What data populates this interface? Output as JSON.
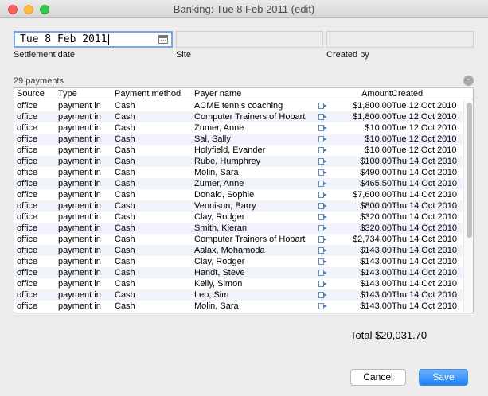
{
  "window": {
    "title": "Banking: Tue 8 Feb 2011 (edit)"
  },
  "form": {
    "settlement_date": {
      "value": "Tue 8 Feb 2011",
      "label": "Settlement date"
    },
    "site": {
      "value": "",
      "label": "Site"
    },
    "created_by": {
      "value": "",
      "label": "Created by"
    }
  },
  "payments": {
    "count_label": "29 payments",
    "remove_label": "−",
    "columns": [
      "Source",
      "Type",
      "Payment method",
      "Payer name",
      "Amount",
      "Created"
    ],
    "rows": [
      {
        "source": "office",
        "type": "payment in",
        "method": "Cash",
        "payer": "ACME tennis coaching",
        "amount": "$1,800.00",
        "created": "Tue 12 Oct 2010"
      },
      {
        "source": "office",
        "type": "payment in",
        "method": "Cash",
        "payer": "Computer Trainers of Hobart",
        "amount": "$1,800.00",
        "created": "Tue 12 Oct 2010"
      },
      {
        "source": "office",
        "type": "payment in",
        "method": "Cash",
        "payer": "Zumer, Anne",
        "amount": "$10.00",
        "created": "Tue 12 Oct 2010"
      },
      {
        "source": "office",
        "type": "payment in",
        "method": "Cash",
        "payer": "Sal, Sally",
        "amount": "$10.00",
        "created": "Tue 12 Oct 2010"
      },
      {
        "source": "office",
        "type": "payment in",
        "method": "Cash",
        "payer": "Holyfield, Evander",
        "amount": "$10.00",
        "created": "Tue 12 Oct 2010"
      },
      {
        "source": "office",
        "type": "payment in",
        "method": "Cash",
        "payer": "Rube, Humphrey",
        "amount": "$100.00",
        "created": "Thu 14 Oct 2010"
      },
      {
        "source": "office",
        "type": "payment in",
        "method": "Cash",
        "payer": "Molin, Sara",
        "amount": "$490.00",
        "created": "Thu 14 Oct 2010"
      },
      {
        "source": "office",
        "type": "payment in",
        "method": "Cash",
        "payer": "Zumer, Anne",
        "amount": "$465.50",
        "created": "Thu 14 Oct 2010"
      },
      {
        "source": "office",
        "type": "payment in",
        "method": "Cash",
        "payer": "Donald, Sophie",
        "amount": "$7,600.00",
        "created": "Thu 14 Oct 2010"
      },
      {
        "source": "office",
        "type": "payment in",
        "method": "Cash",
        "payer": "Vennison, Barry",
        "amount": "$800.00",
        "created": "Thu 14 Oct 2010"
      },
      {
        "source": "office",
        "type": "payment in",
        "method": "Cash",
        "payer": "Clay, Rodger",
        "amount": "$320.00",
        "created": "Thu 14 Oct 2010"
      },
      {
        "source": "office",
        "type": "payment in",
        "method": "Cash",
        "payer": "Smith, Kieran",
        "amount": "$320.00",
        "created": "Thu 14 Oct 2010"
      },
      {
        "source": "office",
        "type": "payment in",
        "method": "Cash",
        "payer": "Computer Trainers of Hobart",
        "amount": "$2,734.00",
        "created": "Thu 14 Oct 2010"
      },
      {
        "source": "office",
        "type": "payment in",
        "method": "Cash",
        "payer": "Aalax, Mohamoda",
        "amount": "$143.00",
        "created": "Thu 14 Oct 2010"
      },
      {
        "source": "office",
        "type": "payment in",
        "method": "Cash",
        "payer": "Clay, Rodger",
        "amount": "$143.00",
        "created": "Thu 14 Oct 2010"
      },
      {
        "source": "office",
        "type": "payment in",
        "method": "Cash",
        "payer": "Handt, Steve",
        "amount": "$143.00",
        "created": "Thu 14 Oct 2010"
      },
      {
        "source": "office",
        "type": "payment in",
        "method": "Cash",
        "payer": "Kelly, Simon",
        "amount": "$143.00",
        "created": "Thu 14 Oct 2010"
      },
      {
        "source": "office",
        "type": "payment in",
        "method": "Cash",
        "payer": "Leo, Sim",
        "amount": "$143.00",
        "created": "Thu 14 Oct 2010"
      },
      {
        "source": "office",
        "type": "payment in",
        "method": "Cash",
        "payer": "Molin, Sara",
        "amount": "$143.00",
        "created": "Thu 14 Oct 2010"
      }
    ],
    "total_label": "Total $20,031.70"
  },
  "buttons": {
    "cancel": "Cancel",
    "save": "Save"
  },
  "icons": {
    "row_link": "open-record-arrow-icon",
    "date_picker": "calendar-icon"
  }
}
